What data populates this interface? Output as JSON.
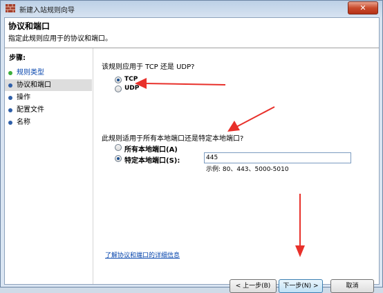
{
  "window": {
    "title": "新建入站规则向导",
    "close_glyph": "✕"
  },
  "header": {
    "title": "协议和端口",
    "subtitle": "指定此规则应用于的协议和端口。"
  },
  "steps": {
    "heading": "步骤:",
    "items": [
      {
        "label": "规则类型",
        "state": "done"
      },
      {
        "label": "协议和端口",
        "state": "active"
      },
      {
        "label": "操作",
        "state": "todo"
      },
      {
        "label": "配置文件",
        "state": "todo"
      },
      {
        "label": "名称",
        "state": "todo"
      }
    ]
  },
  "protocol": {
    "question": "该规则应用于 TCP 还是 UDP?",
    "options": [
      {
        "label": "TCP",
        "checked": true
      },
      {
        "label": "UDP",
        "checked": false
      }
    ]
  },
  "ports": {
    "question": "此规则适用于所有本地端口还是特定本地端口?",
    "options": [
      {
        "label": "所有本地端口(A)",
        "checked": false
      },
      {
        "label": "特定本地端口(S):",
        "checked": true
      }
    ],
    "value": "445",
    "example": "示例: 80、443、5000-5010"
  },
  "learn_more": "了解协议和端口的详细信息",
  "buttons": {
    "back": "< 上一步(B)",
    "next": "下一步(N) >",
    "cancel": "取消"
  },
  "colors": {
    "annotation_arrow": "#e8302a",
    "link": "#0645ad"
  }
}
